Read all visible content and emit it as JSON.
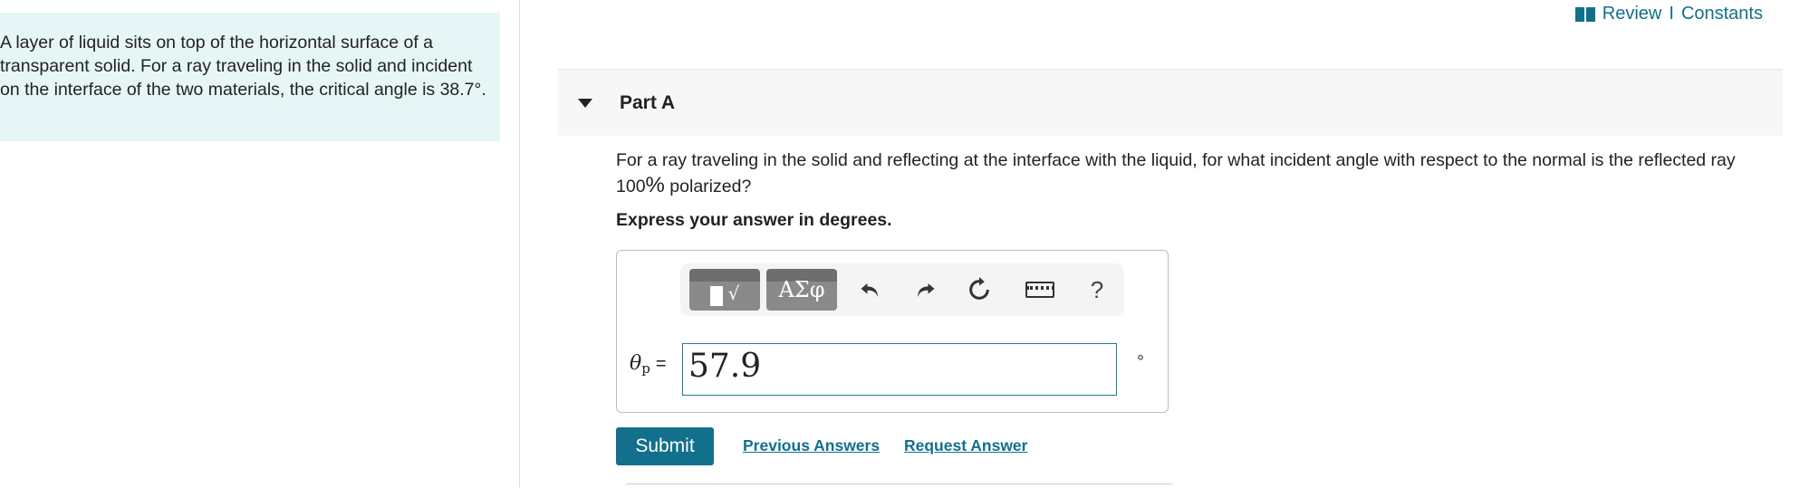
{
  "problem": {
    "text": "A layer of liquid sits on top of the horizontal surface of a transparent solid. For a ray traveling in the solid and incident on the interface of the two materials, the critical angle is 38.7°."
  },
  "header": {
    "review": "Review",
    "separator": "I",
    "constants": "Constants"
  },
  "part": {
    "title": "Part A",
    "question_before": "For a ray traveling in the solid and reflecting at the interface with the liquid, for what incident angle with respect to the normal is the reflected ray 100",
    "question_percent": "%",
    "question_after": " polarized?",
    "instruction": "Express your answer in degrees."
  },
  "toolbar": {
    "math_glyph": "√",
    "greek_label": "ΑΣφ",
    "help": "?"
  },
  "answer": {
    "variable": "θ",
    "subscript": "p",
    "equals": "=",
    "value": "57.9",
    "unit": "°"
  },
  "actions": {
    "submit": "Submit",
    "previous_answers": "Previous Answers",
    "request_answer": "Request Answer"
  },
  "colors": {
    "accent": "#12708c",
    "problem_bg": "#e6f6f7"
  }
}
